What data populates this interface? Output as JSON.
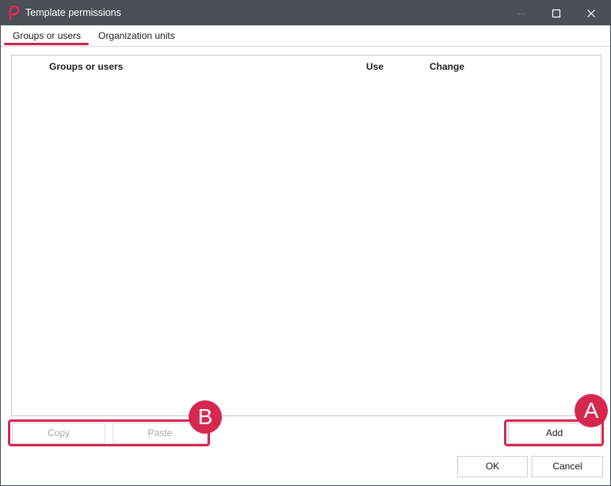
{
  "window": {
    "title": "Template permissions",
    "app_icon": "pdf-app-icon",
    "controls": [
      "minimize-icon",
      "maximize-icon",
      "close-icon"
    ]
  },
  "tabs": [
    {
      "label": "Groups or users",
      "active": true
    },
    {
      "label": "Organization units",
      "active": false
    }
  ],
  "table": {
    "columns": [
      "Groups or users",
      "Use",
      "Change"
    ],
    "rows": []
  },
  "buttons": {
    "copy": "Copy",
    "paste": "Paste",
    "add": "Add",
    "ok": "OK",
    "cancel": "Cancel"
  },
  "markers": {
    "a": "A",
    "b": "B"
  },
  "colors": {
    "titlebar": "#4a5056",
    "accent": "#d01f4a",
    "highlight": "#d6284f"
  }
}
